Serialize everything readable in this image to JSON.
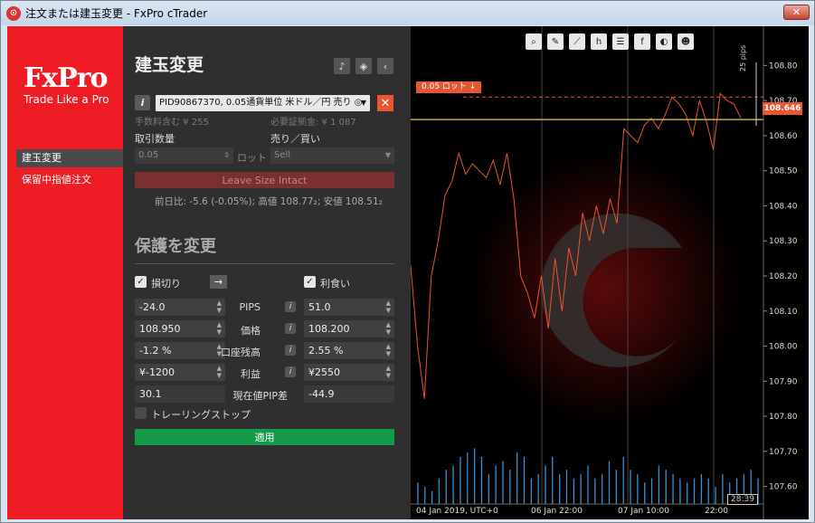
{
  "window": {
    "title": "注文または建玉変更 - FxPro cTrader",
    "close": "✕"
  },
  "sidebar": {
    "logo": "FxPro",
    "tagline": "Trade Like a Pro",
    "items": [
      {
        "label": "建玉変更",
        "active": true
      },
      {
        "label": "保留中指値注文",
        "active": false
      }
    ]
  },
  "panel": {
    "title": "建玉変更",
    "icons": [
      "bell-icon",
      "shield-icon",
      "chevron-left-icon"
    ],
    "position_select": "PID90867370, 0.05通貨単位 米ドル／円 売り ◎",
    "commission": "手数料含む ¥ 255",
    "required_margin": "必要証拠金: ¥ 1 087",
    "qty_label": "取引数量",
    "qty_value": "0.05",
    "qty_unit": "ロット",
    "side_label": "売り／買い",
    "side_value": "Sell",
    "leave_size_btn": "Leave Size Intact",
    "day_stats": "前日比: -5.6 (-0.05%); 高値 108.77₂; 安値 108.51₂",
    "protect_title": "保護を変更",
    "stop_loss_label": "損切り",
    "take_profit_label": "利食い",
    "rows": [
      {
        "label": "PIPS",
        "sl": "-24.0",
        "tp": "51.0"
      },
      {
        "label": "価格",
        "sl": "108.950",
        "tp": "108.200"
      },
      {
        "label": "口座残高",
        "sl": "-1.2 %",
        "tp": "2.55 %"
      },
      {
        "label": "利益",
        "sl": "¥-1200",
        "tp": "¥2550"
      }
    ],
    "pip_diff_label": "現在値PIP差",
    "pip_diff_sl": "30.1",
    "pip_diff_tp": "-44.9",
    "trailing_stop": "トレーリングストップ",
    "apply_btn": "適用"
  },
  "chart": {
    "order_tag": "0.05 ロット ↓",
    "price_tag": "108.646",
    "pips_label": "25 pips",
    "time_cursor": "28:39",
    "colors": {
      "line": "#e8552f",
      "volume": "#3a8fd0",
      "current": "#c9b03a"
    },
    "toolbar": [
      "zoom-icon",
      "draw-icon",
      "indicator-icon",
      "timeframe-icon",
      "list-icon",
      "fb-icon",
      "sentiment-icon",
      "person-icon"
    ]
  },
  "chart_data": {
    "type": "line",
    "y_ticks": [
      "108.80",
      "108.70",
      "108.60",
      "108.50",
      "108.40",
      "108.30",
      "108.20",
      "108.10",
      "108.00",
      "107.90",
      "107.80",
      "107.70",
      "107.60"
    ],
    "x_ticks": [
      "04 Jan 2019, UTC+0",
      "06 Jan 22:00",
      "07 Jan 10:00",
      "22:00"
    ],
    "ylim": [
      107.55,
      108.85
    ],
    "current_price": 108.646,
    "order_price": 108.71,
    "values": [
      108.23,
      108.0,
      107.85,
      108.2,
      108.3,
      108.43,
      108.47,
      108.55,
      108.49,
      108.52,
      108.5,
      108.48,
      108.53,
      108.46,
      108.55,
      108.42,
      108.2,
      108.15,
      108.08,
      108.2,
      108.05,
      108.25,
      108.1,
      108.28,
      108.2,
      108.38,
      108.3,
      108.4,
      108.32,
      108.42,
      108.35,
      108.62,
      108.6,
      108.58,
      108.63,
      108.65,
      108.62,
      108.66,
      108.71,
      108.69,
      108.66,
      108.6,
      108.7,
      108.64,
      108.56,
      108.72,
      108.7,
      108.69,
      108.65
    ],
    "volumes": [
      25,
      20,
      15,
      30,
      40,
      45,
      55,
      60,
      65,
      55,
      35,
      45,
      50,
      40,
      60,
      55,
      30,
      35,
      45,
      55,
      35,
      40,
      30,
      35,
      45,
      30,
      35,
      50,
      40,
      55,
      40,
      35,
      25,
      30,
      45,
      40,
      35,
      30,
      25,
      30,
      35,
      30,
      20,
      35,
      25,
      30,
      35,
      40,
      30
    ]
  }
}
